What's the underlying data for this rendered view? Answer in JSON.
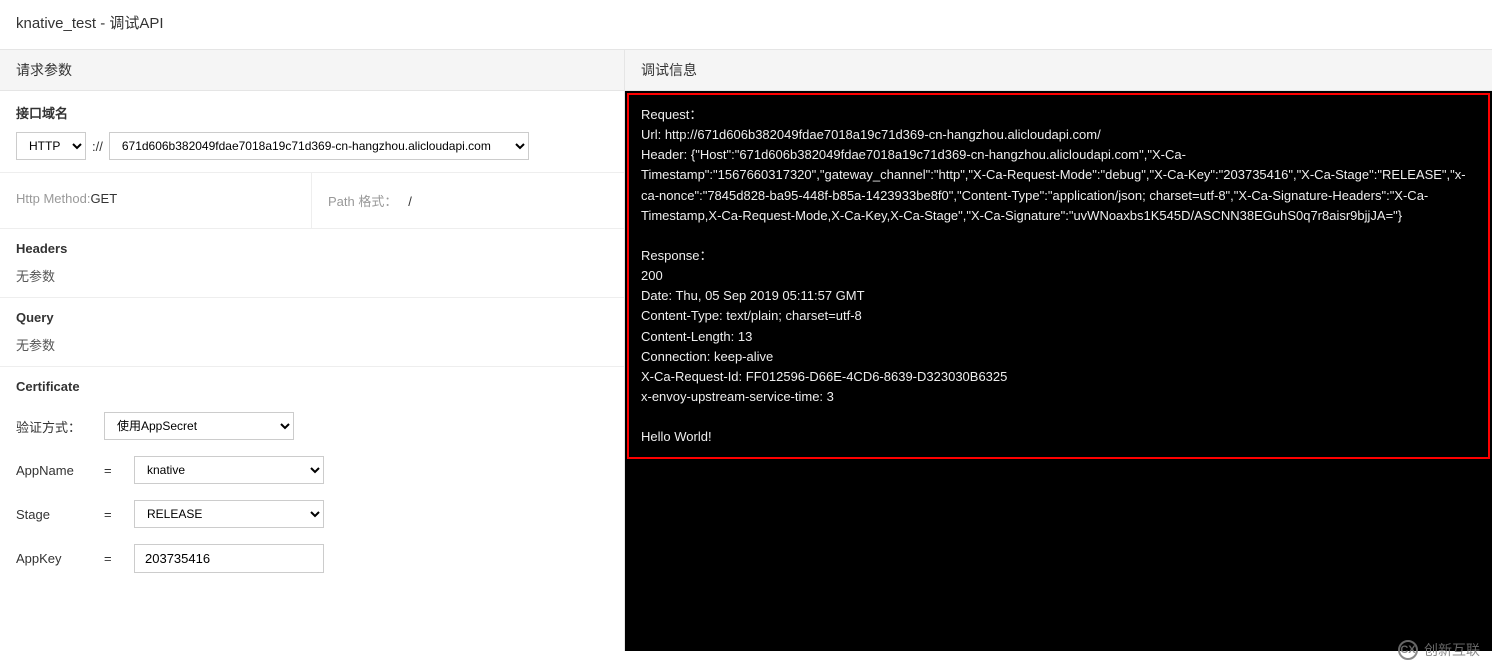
{
  "title": "knative_test - 调试API",
  "left": {
    "header": "请求参数",
    "domain": {
      "label": "接口域名",
      "protocol": "HTTP",
      "separator": "://",
      "host": "671d606b382049fdae7018a19c71d369-cn-hangzhou.alicloudapi.com"
    },
    "method": {
      "label": "Http Method:",
      "value": "GET"
    },
    "path": {
      "label": "Path 格式：",
      "value": "/"
    },
    "headers": {
      "title": "Headers",
      "empty": "无参数"
    },
    "query": {
      "title": "Query",
      "empty": "无参数"
    },
    "certificate": {
      "title": "Certificate",
      "auth": {
        "label": "验证方式：",
        "value": "使用AppSecret"
      },
      "appname": {
        "label": "AppName",
        "value": "knative"
      },
      "stage": {
        "label": "Stage",
        "value": "RELEASE"
      },
      "appkey": {
        "label": "AppKey",
        "value": "203735416"
      }
    }
  },
  "right": {
    "header": "调试信息",
    "console": "Request：\nUrl: http://671d606b382049fdae7018a19c71d369-cn-hangzhou.alicloudapi.com/\nHeader: {\"Host\":\"671d606b382049fdae7018a19c71d369-cn-hangzhou.alicloudapi.com\",\"X-Ca-Timestamp\":\"1567660317320\",\"gateway_channel\":\"http\",\"X-Ca-Request-Mode\":\"debug\",\"X-Ca-Key\":\"203735416\",\"X-Ca-Stage\":\"RELEASE\",\"x-ca-nonce\":\"7845d828-ba95-448f-b85a-1423933be8f0\",\"Content-Type\":\"application/json; charset=utf-8\",\"X-Ca-Signature-Headers\":\"X-Ca-Timestamp,X-Ca-Request-Mode,X-Ca-Key,X-Ca-Stage\",\"X-Ca-Signature\":\"uvWNoaxbs1K545D/ASCNN38EGuhS0q7r8aisr9bjjJA=\"}\n\nResponse：\n200\nDate: Thu, 05 Sep 2019 05:11:57 GMT\nContent-Type: text/plain; charset=utf-8\nContent-Length: 13\nConnection: keep-alive\nX-Ca-Request-Id: FF012596-D66E-4CD6-8639-D323030B6325\nx-envoy-upstream-service-time: 3\n\nHello World!"
  },
  "watermark": {
    "icon": "CX",
    "text": "创新互联"
  }
}
